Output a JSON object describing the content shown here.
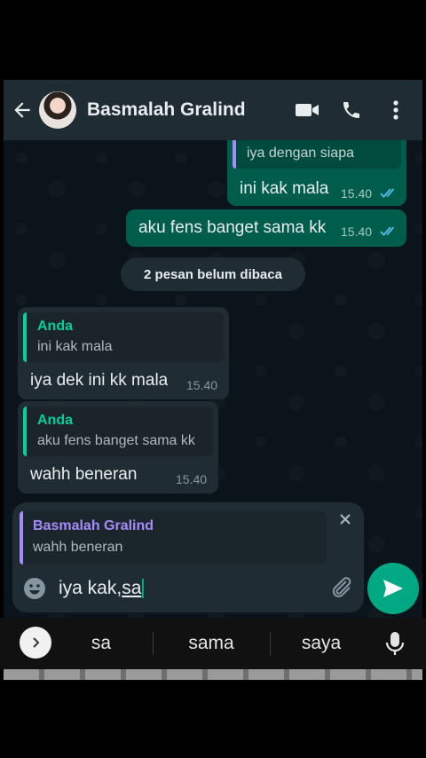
{
  "header": {
    "contact_name": "Basmalah Gralind",
    "icons": [
      "back-arrow-icon",
      "video-call-icon",
      "phone-icon",
      "more-vert-icon"
    ]
  },
  "messages": [
    {
      "direction": "out",
      "quote_text": "iya dengan siapa",
      "text": "ini kak mala",
      "time": "15.40",
      "status": "read"
    },
    {
      "direction": "out",
      "text": "aku fens banget sama kk",
      "time": "15.40",
      "status": "read"
    },
    {
      "direction": "in",
      "quote_name": "Anda",
      "quote_text": "ini kak mala",
      "text": "iya dek ini kk mala",
      "time": "15.40"
    },
    {
      "direction": "in",
      "quote_name": "Anda",
      "quote_text": "aku fens banget sama kk",
      "text": "wahh beneran",
      "time": "15.40"
    }
  ],
  "unread_banner": "2 pesan belum dibaca",
  "composer": {
    "reply_name": "Basmalah Gralind",
    "reply_text": "wahh beneran",
    "input_prefix": "iya kak,",
    "input_underlined": "sa"
  },
  "keyboard": {
    "suggestions": [
      "sa",
      "sama",
      "saya"
    ]
  },
  "colors": {
    "header_bg": "#1f2c34",
    "chat_bg": "#0b141a",
    "outgoing_bubble": "#005c4b",
    "incoming_bubble": "#202c33",
    "accent": "#00a884",
    "quote_you": "#06cf9c",
    "quote_contact": "#a78bfa"
  }
}
